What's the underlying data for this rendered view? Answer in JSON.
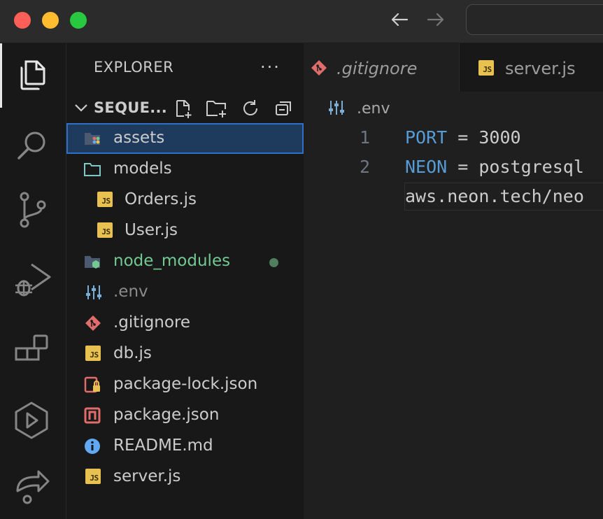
{
  "titlebar": {
    "back_icon": "arrow-left-icon",
    "forward_icon": "arrow-right-icon"
  },
  "activity_bar": {
    "items": [
      {
        "name": "explorer",
        "icon": "files-icon",
        "active": true
      },
      {
        "name": "search",
        "icon": "search-icon"
      },
      {
        "name": "source-control",
        "icon": "source-control-icon"
      },
      {
        "name": "run-debug",
        "icon": "run-debug-icon"
      },
      {
        "name": "extensions",
        "icon": "extensions-icon"
      },
      {
        "name": "remote-explorer",
        "icon": "remote-explorer-icon"
      },
      {
        "name": "live-share",
        "icon": "live-share-icon"
      }
    ]
  },
  "sidebar": {
    "title": "EXPLORER",
    "more": "···",
    "folder": {
      "name": "SEQUE...",
      "actions": [
        "new-file-icon",
        "new-folder-icon",
        "refresh-icon",
        "collapse-all-icon"
      ]
    },
    "tree": [
      {
        "label": "assets",
        "type": "folder-assets",
        "selected": true
      },
      {
        "label": "models",
        "type": "folder"
      },
      {
        "label": "Orders.js",
        "type": "js",
        "indent": 1
      },
      {
        "label": "User.js",
        "type": "js",
        "indent": 1
      },
      {
        "label": "node_modules",
        "type": "folder-node",
        "git_status": "modified"
      },
      {
        "label": ".env",
        "type": "env",
        "dimmed": true
      },
      {
        "label": ".gitignore",
        "type": "git"
      },
      {
        "label": "db.js",
        "type": "js"
      },
      {
        "label": "package-lock.json",
        "type": "lock"
      },
      {
        "label": "package.json",
        "type": "npm"
      },
      {
        "label": "README.md",
        "type": "info"
      },
      {
        "label": "server.js",
        "type": "js"
      }
    ]
  },
  "editor": {
    "tabs": [
      {
        "label": ".gitignore",
        "icon": "git-icon",
        "active": true,
        "preview": true
      },
      {
        "label": "server.js",
        "icon": "js-icon"
      }
    ],
    "breadcrumb": ".env",
    "lines": [
      {
        "number": "1",
        "key": "PORT",
        "op": " = ",
        "value": "3000"
      },
      {
        "number": "2",
        "key": "NEON",
        "op": " = ",
        "value": "postgresql"
      },
      {
        "number": "",
        "key": "",
        "op": "",
        "value": "aws.neon.tech/neo"
      }
    ]
  },
  "colors": {
    "accent": "#2f6fc5",
    "js": "#e8c151",
    "git": "#e06c6c",
    "modified": "#73c991",
    "keyword": "#569cd6"
  }
}
